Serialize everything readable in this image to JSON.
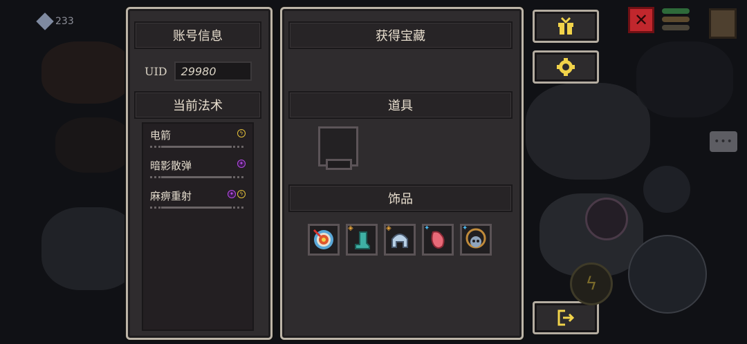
{
  "hud": {
    "coins": "233"
  },
  "account": {
    "title": "账号信息",
    "uid_label": "UID",
    "uid_value": "29980"
  },
  "spells": {
    "title": "当前法术",
    "items": [
      {
        "name": "电箭",
        "badges": [
          "lightning"
        ]
      },
      {
        "name": "暗影散弹",
        "badges": [
          "shadow"
        ]
      },
      {
        "name": "麻痹重射",
        "badges": [
          "shadow",
          "lightning"
        ]
      }
    ]
  },
  "treasure": {
    "title": "获得宝藏",
    "items_title": "道具",
    "accessories_title": "饰品",
    "accessories": [
      {
        "icon": "target-icon"
      },
      {
        "icon": "boot-icon"
      },
      {
        "icon": "helmet-icon"
      },
      {
        "icon": "heart-icon"
      },
      {
        "icon": "skull-necklace-icon"
      }
    ]
  },
  "side_buttons": [
    {
      "icon": "gift-icon"
    },
    {
      "icon": "gear-icon"
    },
    {
      "icon": "exit-icon"
    }
  ],
  "colors": {
    "panel_border": "#bdb5a8",
    "panel_bg": "#2f2c2e",
    "text": "#e9dfcf",
    "lightning": "#e6c23a",
    "shadow": "#b74ae6",
    "icon_yellow": "#f1d34a"
  }
}
